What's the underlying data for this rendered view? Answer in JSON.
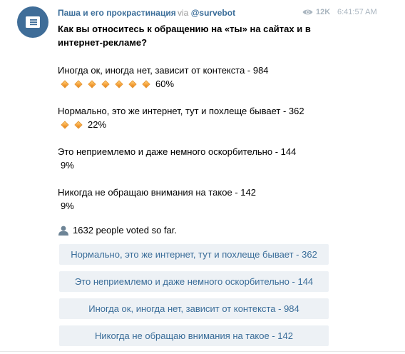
{
  "message": {
    "author": "Паша и его прокрастинация",
    "via_label": "via",
    "via_bot": "@survebot",
    "views": "12K",
    "time": "6:41:57 AM"
  },
  "poll": {
    "question": "Как вы относитесь к обращению на «ты» на сайтах и в интернет-рекламе?",
    "options": [
      {
        "label": "Иногда ок, иногда нет, зависит от контекста - 984",
        "percent": "60%",
        "bar_icons": 7
      },
      {
        "label": "Нормально, это же интернет, тут и похлеще бывает - 362",
        "percent": "22%",
        "bar_icons": 2
      },
      {
        "label": "Это неприемлемо и даже немного оскорбительно - 144",
        "percent": "9%",
        "bar_icons": 0
      },
      {
        "label": "Никогда не обращаю внимания на такое - 142",
        "percent": "9%",
        "bar_icons": 0
      }
    ],
    "voted_text": "1632 people voted so far.",
    "buttons": [
      "Нормально, это же интернет, тут и похлеще бывает - 362",
      "Это неприемлемо и даже немного оскорбительно - 144",
      "Иногда ок, иногда нет, зависит от контекста - 984",
      "Никогда не обращаю внимания на такое - 142"
    ]
  },
  "icons": {
    "avatar": "channel-megaphone-icon",
    "views": "eye-icon",
    "voted": "user-icon",
    "bar": "orange-diamond-icon"
  },
  "colors": {
    "avatar_bg": "#3f6d98",
    "link": "#3a6d99",
    "button_bg": "#edf1f5",
    "muted": "#aab6c0"
  }
}
